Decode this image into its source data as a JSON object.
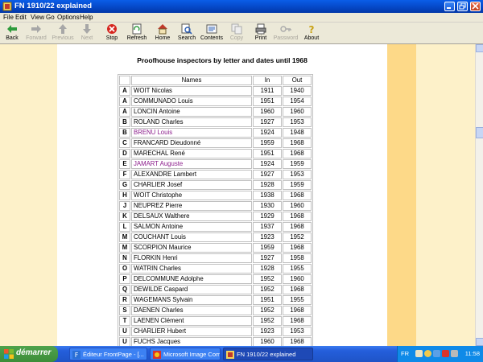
{
  "window": {
    "title": "FN 1910/22 explained"
  },
  "menu": [
    "File",
    "Edit",
    "View",
    "Go",
    "Options",
    "Help"
  ],
  "toolbar": [
    {
      "label": "Back",
      "icon": "back-arrow-icon",
      "enabled": true
    },
    {
      "label": "Forward",
      "icon": "forward-arrow-icon",
      "enabled": false
    },
    {
      "label": "Previous",
      "icon": "previous-icon",
      "enabled": false
    },
    {
      "label": "Next",
      "icon": "next-icon",
      "enabled": false
    },
    {
      "label": "Stop",
      "icon": "stop-icon",
      "enabled": true
    },
    {
      "label": "Refresh",
      "icon": "refresh-icon",
      "enabled": true
    },
    {
      "label": "Home",
      "icon": "home-icon",
      "enabled": true
    },
    {
      "label": "Search",
      "icon": "search-icon",
      "enabled": true
    },
    {
      "label": "Contents",
      "icon": "contents-icon",
      "enabled": true
    },
    {
      "label": "Copy",
      "icon": "copy-icon",
      "enabled": false
    },
    {
      "label": "Print",
      "icon": "print-icon",
      "enabled": true
    },
    {
      "label": "Password",
      "icon": "password-key-icon",
      "enabled": false
    },
    {
      "label": "About",
      "icon": "about-icon",
      "enabled": true
    }
  ],
  "page": {
    "heading": "Proofhouse inspectors by letter and dates until 1968",
    "columns": [
      "Names",
      "In",
      "Out"
    ],
    "rows": [
      {
        "letter": "A",
        "name": "WOIT Nicolas",
        "in": "1911",
        "out": "1940",
        "link": false
      },
      {
        "letter": "A",
        "name": "COMMUNADO Louis",
        "in": "1951",
        "out": "1954",
        "link": false
      },
      {
        "letter": "A",
        "name": "LONCIN Antoine",
        "in": "1960",
        "out": "1960",
        "link": false
      },
      {
        "letter": "B",
        "name": "ROLAND Charles",
        "in": "1927",
        "out": "1953",
        "link": false
      },
      {
        "letter": "B",
        "name": "BRENU Louis",
        "in": "1924",
        "out": "1948",
        "link": true
      },
      {
        "letter": "C",
        "name": "FRANCARD Dieudonné",
        "in": "1959",
        "out": "1968",
        "link": false
      },
      {
        "letter": "D",
        "name": "MARECHAL René",
        "in": "1951",
        "out": "1968",
        "link": false
      },
      {
        "letter": "E",
        "name": "JAMART Auguste",
        "in": "1924",
        "out": "1959",
        "link": true
      },
      {
        "letter": "F",
        "name": "ALEXANDRE Lambert",
        "in": "1927",
        "out": "1953",
        "link": false
      },
      {
        "letter": "G",
        "name": "CHARLIER Josef",
        "in": "1928",
        "out": "1959",
        "link": false
      },
      {
        "letter": "H",
        "name": "WOIT Christophe",
        "in": "1938",
        "out": "1968",
        "link": false
      },
      {
        "letter": "J",
        "name": "NEUPREZ Pierre",
        "in": "1930",
        "out": "1960",
        "link": false
      },
      {
        "letter": "K",
        "name": "DELSAUX Walthere",
        "in": "1929",
        "out": "1968",
        "link": false
      },
      {
        "letter": "L",
        "name": "SALMON Antoine",
        "in": "1937",
        "out": "1968",
        "link": false
      },
      {
        "letter": "M",
        "name": "COUCHANT Louis",
        "in": "1923",
        "out": "1952",
        "link": false
      },
      {
        "letter": "M",
        "name": "SCORPION Maurice",
        "in": "1959",
        "out": "1968",
        "link": false
      },
      {
        "letter": "N",
        "name": "FLORKIN Henri",
        "in": "1927",
        "out": "1958",
        "link": false
      },
      {
        "letter": "O",
        "name": "WATRIN Charles",
        "in": "1928",
        "out": "1955",
        "link": false
      },
      {
        "letter": "P",
        "name": "DELCOMMUNE Adolphe",
        "in": "1952",
        "out": "1960",
        "link": false
      },
      {
        "letter": "Q",
        "name": "DEWILDE Caspard",
        "in": "1952",
        "out": "1968",
        "link": false
      },
      {
        "letter": "R",
        "name": "WAGEMANS Sylvain",
        "in": "1951",
        "out": "1955",
        "link": false
      },
      {
        "letter": "S",
        "name": "DAENEN Charles",
        "in": "1952",
        "out": "1968",
        "link": false
      },
      {
        "letter": "T",
        "name": "LAENEN Clément",
        "in": "1952",
        "out": "1968",
        "link": false
      },
      {
        "letter": "U",
        "name": "CHARLIER Hubert",
        "in": "1923",
        "out": "1953",
        "link": false
      },
      {
        "letter": "U",
        "name": "FUCHS Jacques",
        "in": "1960",
        "out": "1968",
        "link": false
      }
    ]
  },
  "taskbar": {
    "start_label": "démarrer",
    "tasks": [
      {
        "label": "Éditeur FrontPage - [...",
        "active": false
      },
      {
        "label": "Microsoft Image Com...",
        "active": false
      },
      {
        "label": "FN 1910/22 explained",
        "active": true
      }
    ],
    "language": "FR",
    "clock": "11:58"
  },
  "colors": {
    "visited_link": "#8b1c8b",
    "side_band": "#fdf1c9",
    "gold_band": "#fdd988"
  }
}
